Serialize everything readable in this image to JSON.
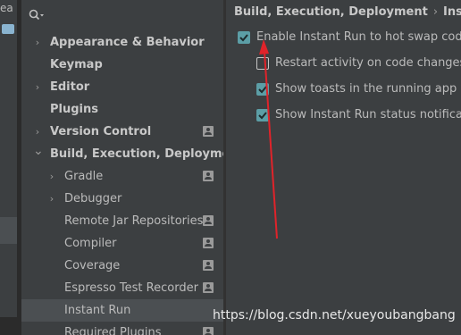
{
  "edge": {
    "text": "ea"
  },
  "search": {
    "icon": "search-icon"
  },
  "tree": {
    "items": [
      {
        "label": "Appearance & Behavior",
        "expandable": true,
        "expanded": false,
        "bold": true,
        "project_icon": false
      },
      {
        "label": "Keymap",
        "expandable": false,
        "bold": true,
        "project_icon": false
      },
      {
        "label": "Editor",
        "expandable": true,
        "expanded": false,
        "bold": true,
        "project_icon": false
      },
      {
        "label": "Plugins",
        "expandable": false,
        "bold": true,
        "project_icon": false
      },
      {
        "label": "Version Control",
        "expandable": true,
        "expanded": false,
        "bold": true,
        "project_icon": true
      },
      {
        "label": "Build, Execution, Deployment",
        "expandable": true,
        "expanded": true,
        "bold": true,
        "project_icon": false
      },
      {
        "label": "Gradle",
        "expandable": true,
        "expanded": false,
        "bold": false,
        "project_icon": true
      },
      {
        "label": "Debugger",
        "expandable": true,
        "expanded": false,
        "bold": false,
        "project_icon": false
      },
      {
        "label": "Remote Jar Repositories",
        "expandable": false,
        "bold": false,
        "project_icon": true
      },
      {
        "label": "Compiler",
        "expandable": false,
        "bold": false,
        "project_icon": true
      },
      {
        "label": "Coverage",
        "expandable": false,
        "bold": false,
        "project_icon": true
      },
      {
        "label": "Espresso Test Recorder",
        "expandable": false,
        "bold": false,
        "project_icon": true
      },
      {
        "label": "Instant Run",
        "expandable": false,
        "bold": false,
        "project_icon": false,
        "selected": true
      },
      {
        "label": "Required Plugins",
        "expandable": false,
        "bold": false,
        "project_icon": true
      }
    ]
  },
  "breadcrumb": {
    "parent": "Build, Execution, Deployment",
    "separator": "›",
    "current": "Instant"
  },
  "options": [
    {
      "label": "Enable Instant Run to hot swap code/re",
      "checked": true
    },
    {
      "label": "Restart activity on code changes",
      "checked": false
    },
    {
      "label": "Show toasts in the running app whe",
      "checked": true
    },
    {
      "label": "Show Instant Run status notifications",
      "checked": true
    }
  ],
  "watermark": "https://blog.csdn.net/xueyoubangbang",
  "colors": {
    "background": "#3c3f41",
    "selection": "#4b4f52",
    "checkbox_checked": "#5c9ea6",
    "annotation_arrow": "#e0232a"
  }
}
